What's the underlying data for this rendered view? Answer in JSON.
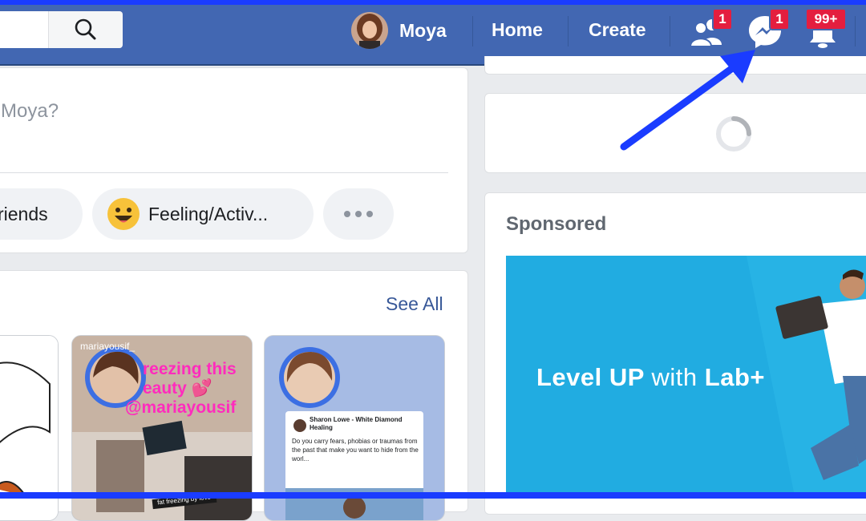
{
  "nav": {
    "search_placeholder": "",
    "profile_name": "Moya",
    "home": "Home",
    "create": "Create",
    "friend_requests_badge": "1",
    "messenger_badge": "1",
    "notifications_badge": "99+"
  },
  "composer": {
    "prompt_partial": "Moya?",
    "tag_friends_label": "riends",
    "feeling_label": "Feeling/Activ..."
  },
  "stories": {
    "see_all": "See All",
    "items": [
      {
        "username": "mariayousif_",
        "caption_lines": [
          "reezing this",
          "eauty 💕",
          "@mariayousif"
        ],
        "sticker": "fat freezing by love"
      },
      {
        "post_author": "Sharon Lowe - White Diamond Healing",
        "post_text": "Do you carry fears, phobias or traumas from the past that make you want to hide from the worl..."
      }
    ]
  },
  "right": {
    "sponsored_title": "Sponsored",
    "ad_headline_a": "Level UP",
    "ad_headline_b": "with",
    "ad_headline_c": "Lab+"
  },
  "colors": {
    "nav_bg": "#4267b2",
    "badge": "#e41e3f",
    "link": "#385898",
    "annotation_arrow": "#1a3cff",
    "ad_bg": "#21ace1"
  },
  "icons": [
    "search-icon",
    "friends-icon",
    "messenger-icon",
    "bell-icon",
    "more-dots-icon",
    "emoji-icon",
    "loading-spinner-icon"
  ]
}
